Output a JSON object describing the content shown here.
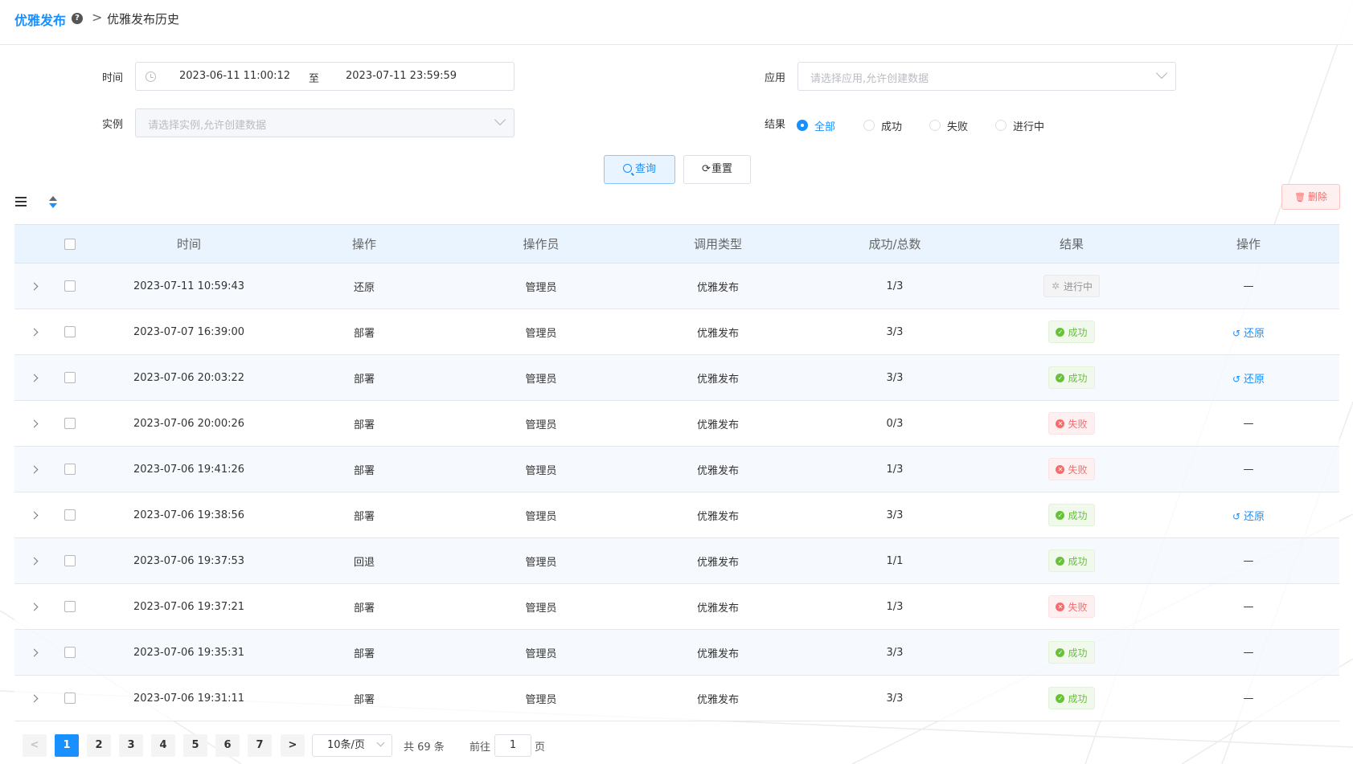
{
  "header": {
    "title": "优雅发布",
    "help": "?",
    "separator": ">",
    "current": "优雅发布历史"
  },
  "filters": {
    "time_label": "时间",
    "start_time": "2023-06-11 11:00:12",
    "range_sep": "至",
    "end_time": "2023-07-11 23:59:59",
    "app_label": "应用",
    "app_placeholder": "请选择应用,允许创建数据",
    "instance_label": "实例",
    "instance_placeholder": "请选择实例,允许创建数据",
    "result_label": "结果",
    "result_options": [
      "全部",
      "成功",
      "失败",
      "进行中"
    ],
    "result_selected": "全部"
  },
  "buttons": {
    "query": "查询",
    "reset": "重置",
    "delete": "删除"
  },
  "table": {
    "headers": [
      "时间",
      "操作",
      "操作员",
      "调用类型",
      "成功/总数",
      "结果",
      "操作"
    ],
    "rows": [
      {
        "time": "2023-07-11 10:59:43",
        "op": "还原",
        "operator": "管理员",
        "type": "优雅发布",
        "ratio": "1/3",
        "result": "进行中",
        "status": "running",
        "action": "—"
      },
      {
        "time": "2023-07-07 16:39:00",
        "op": "部署",
        "operator": "管理员",
        "type": "优雅发布",
        "ratio": "3/3",
        "result": "成功",
        "status": "success",
        "action": "还原"
      },
      {
        "time": "2023-07-06 20:03:22",
        "op": "部署",
        "operator": "管理员",
        "type": "优雅发布",
        "ratio": "3/3",
        "result": "成功",
        "status": "success",
        "action": "还原"
      },
      {
        "time": "2023-07-06 20:00:26",
        "op": "部署",
        "operator": "管理员",
        "type": "优雅发布",
        "ratio": "0/3",
        "result": "失败",
        "status": "fail",
        "action": "—"
      },
      {
        "time": "2023-07-06 19:41:26",
        "op": "部署",
        "operator": "管理员",
        "type": "优雅发布",
        "ratio": "1/3",
        "result": "失败",
        "status": "fail",
        "action": "—"
      },
      {
        "time": "2023-07-06 19:38:56",
        "op": "部署",
        "operator": "管理员",
        "type": "优雅发布",
        "ratio": "3/3",
        "result": "成功",
        "status": "success",
        "action": "还原"
      },
      {
        "time": "2023-07-06 19:37:53",
        "op": "回退",
        "operator": "管理员",
        "type": "优雅发布",
        "ratio": "1/1",
        "result": "成功",
        "status": "success",
        "action": "—"
      },
      {
        "time": "2023-07-06 19:37:21",
        "op": "部署",
        "operator": "管理员",
        "type": "优雅发布",
        "ratio": "1/3",
        "result": "失败",
        "status": "fail",
        "action": "—"
      },
      {
        "time": "2023-07-06 19:35:31",
        "op": "部署",
        "operator": "管理员",
        "type": "优雅发布",
        "ratio": "3/3",
        "result": "成功",
        "status": "success",
        "action": "—"
      },
      {
        "time": "2023-07-06 19:31:11",
        "op": "部署",
        "operator": "管理员",
        "type": "优雅发布",
        "ratio": "3/3",
        "result": "成功",
        "status": "success",
        "action": "—"
      }
    ]
  },
  "pagination": {
    "prev": "<",
    "next": ">",
    "pages": [
      "1",
      "2",
      "3",
      "4",
      "5",
      "6",
      "7"
    ],
    "current": "1",
    "page_size": "10条/页",
    "total": "共 69 条",
    "goto_label": "前往",
    "goto_value": "1",
    "goto_suffix": "页"
  },
  "colors": {
    "primary": "#1890ff",
    "success": "#67c23a",
    "danger": "#f56c6c",
    "info": "#909399"
  }
}
